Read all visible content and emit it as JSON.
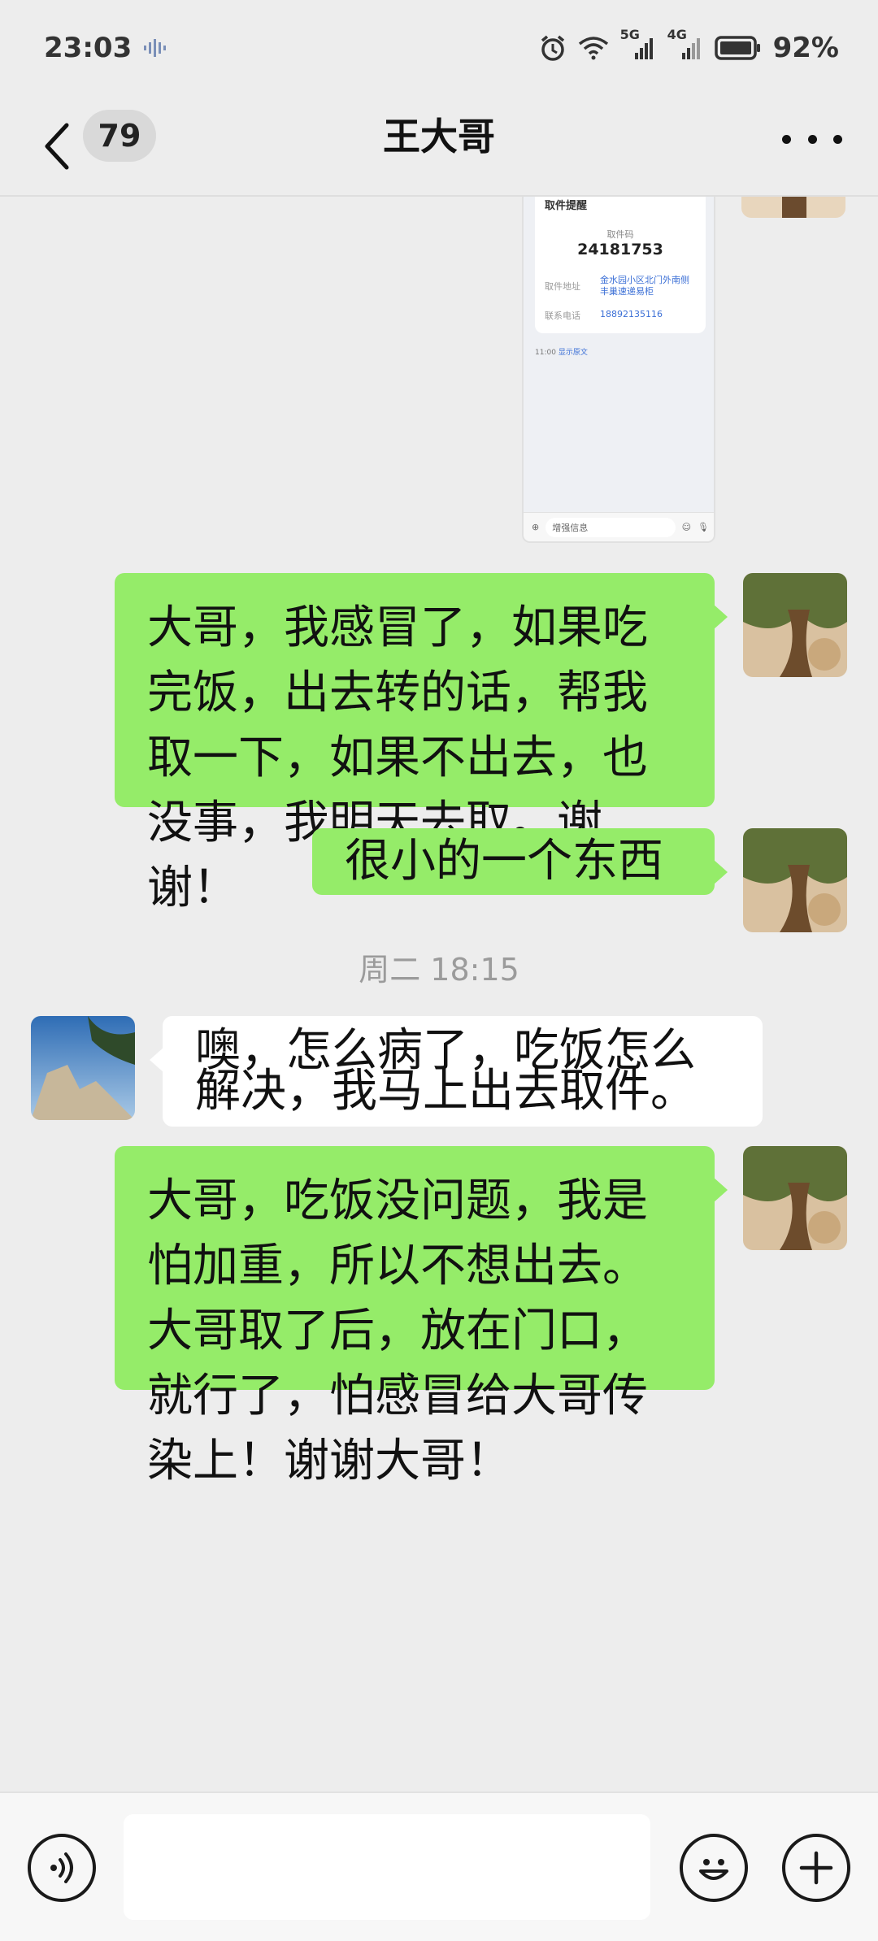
{
  "status": {
    "time": "23:03",
    "network_5g": "5G",
    "network_4g": "4G",
    "battery": "92%"
  },
  "header": {
    "back_count": "79",
    "title": "王大哥"
  },
  "thumbnail": {
    "title": "取件提醒",
    "code_label": "取件码",
    "code": "24181753",
    "address_label": "取件地址",
    "address_value": "金水园小区北门外南侧丰巢速递易柜",
    "phone_label": "联系电话",
    "phone_value": "18892135116",
    "meta_time": "11:00",
    "meta_link": "显示原文",
    "input_placeholder": "增强信息"
  },
  "messages": [
    {
      "from": "me",
      "text": "大哥，我感冒了，如果吃完饭，出去转的话，帮我取一下，如果不出去，也没事，我明天去取。谢谢！"
    },
    {
      "from": "me",
      "text": "很小的一个东西"
    },
    {
      "from": "them",
      "text": "噢，怎么病了，吃饭怎么解决，我马上出去取件。"
    },
    {
      "from": "me",
      "text": "大哥，吃饭没问题，我是怕加重，所以不想出去。大哥取了后，放在门口，就行了，怕感冒给大哥传染上！谢谢大哥！"
    }
  ],
  "timestamp": "周二 18:15",
  "input": {
    "value": ""
  }
}
